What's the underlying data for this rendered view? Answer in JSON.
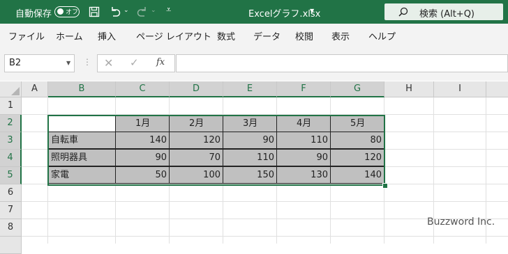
{
  "titlebar": {
    "autosave_label": "自動保存",
    "autosave_state": "オフ",
    "filename": "Excelグラフ.xlsx",
    "search_label": "検索 (Alt+Q)"
  },
  "ribbon": {
    "tabs": [
      "ファイル",
      "ホーム",
      "挿入",
      "ページ レイアウト",
      "数式",
      "データ",
      "校閲",
      "表示",
      "ヘルプ"
    ]
  },
  "formula_bar": {
    "name_box": "B2",
    "fx_label": "fx",
    "formula": ""
  },
  "sheet": {
    "columns": [
      "A",
      "B",
      "C",
      "D",
      "E",
      "F",
      "G",
      "H",
      "I"
    ],
    "rows": [
      "1",
      "2",
      "3",
      "4",
      "5",
      "6",
      "7",
      "8"
    ],
    "table": {
      "header": [
        "",
        "1月",
        "2月",
        "3月",
        "4月",
        "5月"
      ],
      "rows": [
        {
          "label": "自転車",
          "values": [
            "140",
            "120",
            "90",
            "110",
            "80"
          ]
        },
        {
          "label": "照明器具",
          "values": [
            "90",
            "70",
            "110",
            "90",
            "120"
          ]
        },
        {
          "label": "家電",
          "values": [
            "50",
            "100",
            "150",
            "130",
            "140"
          ]
        }
      ]
    }
  },
  "watermark": "Buzzword Inc.",
  "colors": {
    "brand": "#217346",
    "table_fill": "#c0c0c0"
  }
}
